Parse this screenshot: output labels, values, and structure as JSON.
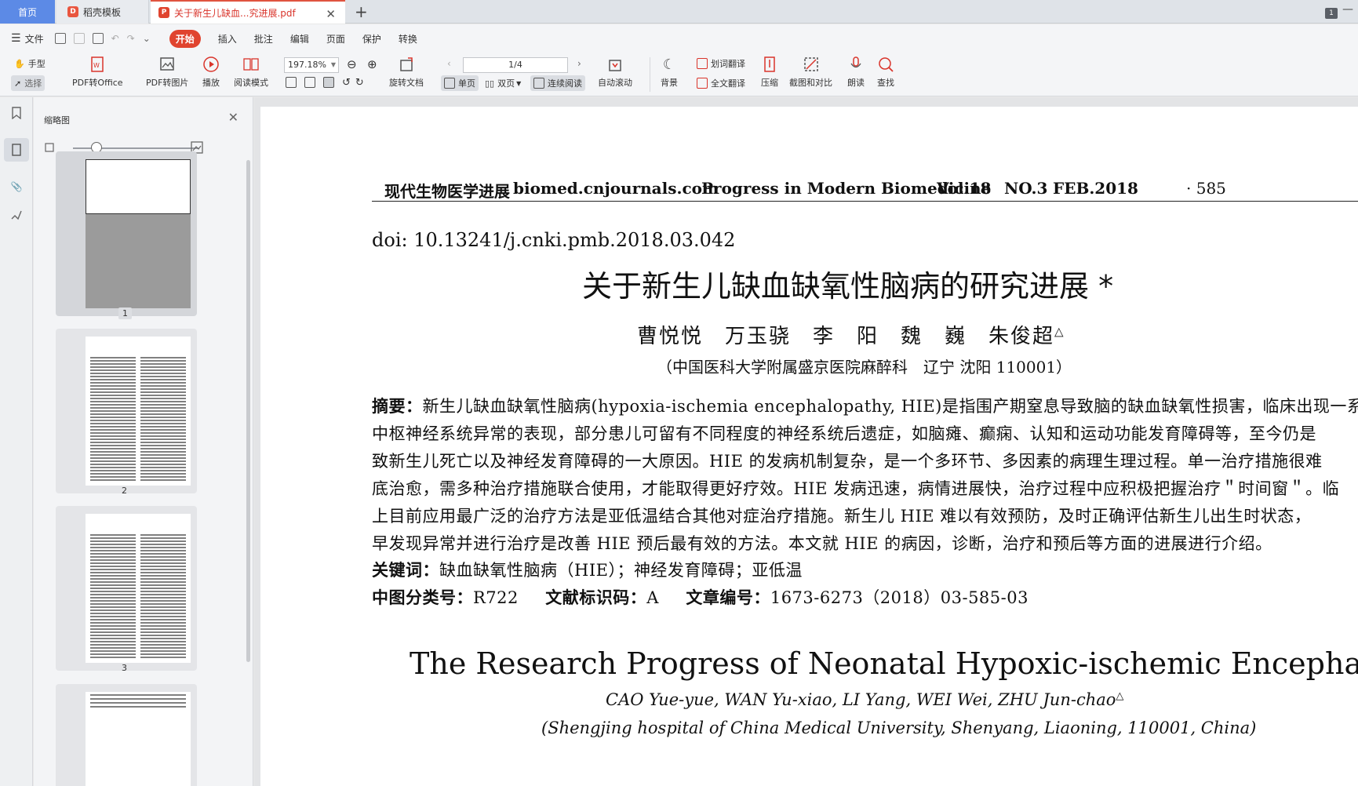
{
  "tabs": {
    "home": "首页",
    "template": "稻壳模板",
    "pdf_file": "关于新生儿缺血...究进展.pdf"
  },
  "window": {
    "badge": "1"
  },
  "menu": {
    "file": "文件",
    "items": [
      "开始",
      "插入",
      "批注",
      "编辑",
      "页面",
      "保护",
      "转换"
    ]
  },
  "toolbar": {
    "hand": "手型",
    "select": "选择",
    "pdf_to_office": "PDF转Office",
    "pdf_to_image": "PDF转图片",
    "play": "播放",
    "read_mode": "阅读模式",
    "zoom": "197.18%",
    "rotate": "旋转文档",
    "page_indicator": "1/4",
    "single_page": "单页",
    "double_page": "双页",
    "continuous": "连续阅读",
    "auto_scroll": "自动滚动",
    "background": "背景",
    "word_translate": "划词翻译",
    "full_translate": "全文翻译",
    "compress": "压缩",
    "screenshot_compare": "截图和对比",
    "read_aloud": "朗读",
    "search": "查找"
  },
  "thumbnails": {
    "title": "缩略图",
    "pages": [
      "1",
      "2",
      "3"
    ]
  },
  "document": {
    "header": {
      "journal_cn": "现代生物医学进展",
      "website": "biomed.cnjournals.com",
      "journal_en": "Progress in Modern Biomedicine",
      "volume": "Vol.18",
      "issue": "NO.3",
      "date": "FEB.2018",
      "page": "· 585"
    },
    "doi": "doi: 10.13241/j.cnki.pmb.2018.03.042",
    "title_cn": "关于新生儿缺血缺氧性脑病的研究进展 *",
    "authors_cn": "曹悦悦　万玉骁　李　阳　魏　巍　朱俊超",
    "authors_cn_mark": "△",
    "affiliation_cn": "（中国医科大学附属盛京医院麻醉科　辽宁 沈阳 110001）",
    "abstract_label": "摘要：",
    "abstract_lines": [
      "新生儿缺血缺氧性脑病(hypoxia-ischemia encephalopathy, HIE)是指围产期窒息导致脑的缺血缺氧性损害，临床出现一系",
      "中枢神经系统异常的表现，部分患儿可留有不同程度的神经系统后遗症，如脑瘫、癫痫、认知和运动功能发育障碍等，至今仍是",
      "致新生儿死亡以及神经发育障碍的一大原因。HIE 的发病机制复杂，是一个多环节、多因素的病理生理过程。单一治疗措施很难",
      "底治愈，需多种治疗措施联合使用，才能取得更好疗效。HIE 发病迅速，病情进展快，治疗过程中应积极把握治疗＂时间窗＂。临",
      "上目前应用最广泛的治疗方法是亚低温结合其他对症治疗措施。新生儿 HIE 难以有效预防，及时正确评估新生儿出生时状态，",
      "早发现异常并进行治疗是改善 HIE 预后最有效的方法。本文就 HIE 的病因，诊断，治疗和预后等方面的进展进行介绍。"
    ],
    "keywords_label": "关键词：",
    "keywords": "缺血缺氧性脑病（HIE）；神经发育障碍；亚低温",
    "clc_label": "中图分类号：",
    "clc": "R722",
    "doc_code_label": "文献标识码：",
    "doc_code": "A",
    "article_no_label": "文章编号：",
    "article_no": "1673-6273（2018）03-585-03",
    "title_en": "The Research Progress of Neonatal Hypoxic-ischemic Encephalopathy*",
    "authors_en": "CAO Yue-yue, WAN Yu-xiao, LI Yang, WEI Wei, ZHU Jun-chao",
    "authors_en_mark": "△",
    "affiliation_en": "(Shengjing hospital of China Medical University, Shenyang, Liaoning, 110001, China)"
  },
  "colors": {
    "accent_red": "#e0442f",
    "home_tab": "#5c8ae6"
  }
}
